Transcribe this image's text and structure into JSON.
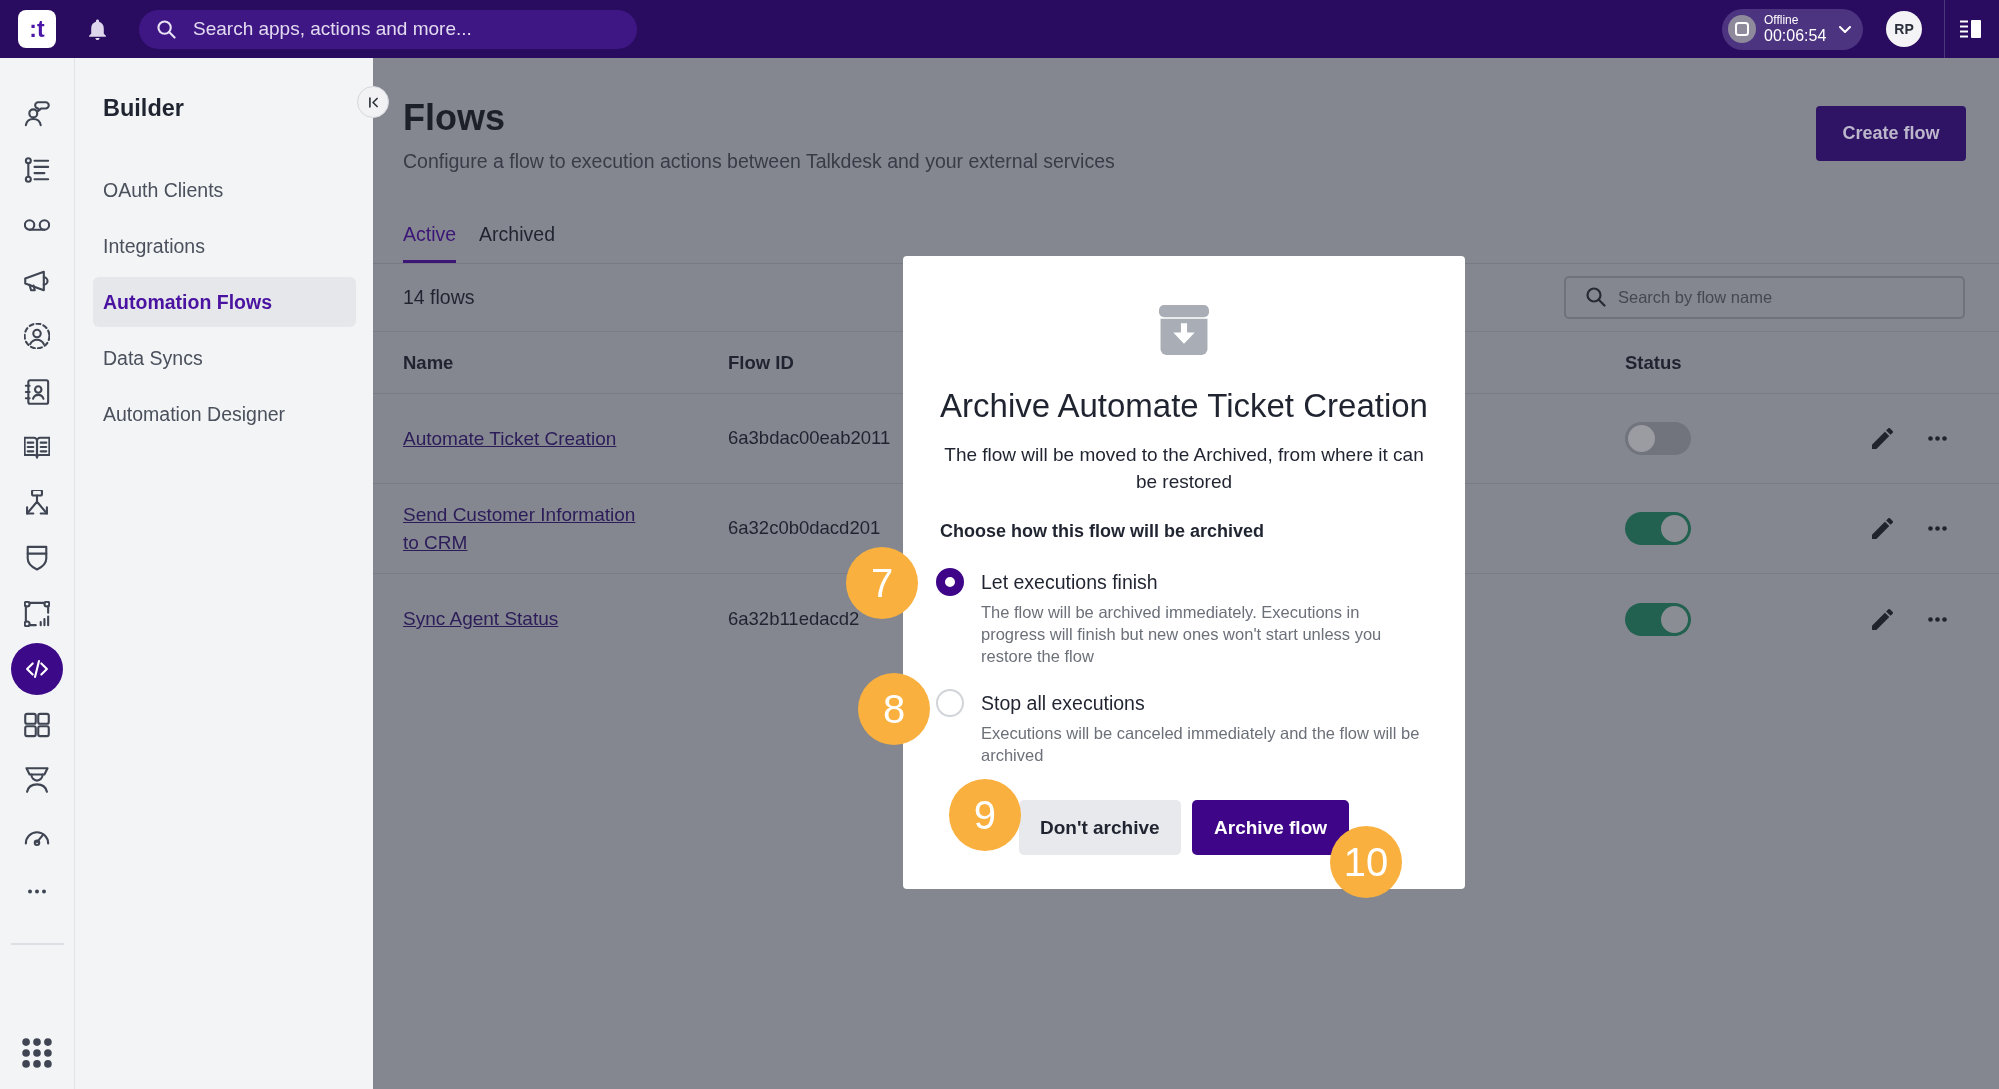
{
  "top_bar": {
    "logo": ":t",
    "search": {
      "placeholder": "Search apps, actions and more..."
    },
    "status": {
      "label": "Offline",
      "timer": "00:06:54"
    },
    "avatar": "RP"
  },
  "rail": {
    "items": [
      {
        "selected": false
      },
      {
        "selected": false
      },
      {
        "selected": false
      },
      {
        "selected": false
      },
      {
        "selected": false
      },
      {
        "selected": false
      },
      {
        "selected": false
      },
      {
        "selected": false
      },
      {
        "selected": false
      },
      {
        "selected": false
      },
      {
        "selected": true
      },
      {
        "selected": false
      },
      {
        "selected": false
      },
      {
        "selected": false
      },
      {
        "selected": false
      }
    ]
  },
  "sidebar": {
    "title": "Builder",
    "items": [
      {
        "label": "OAuth Clients",
        "selected": false
      },
      {
        "label": "Integrations",
        "selected": false
      },
      {
        "label": "Automation Flows",
        "selected": true
      },
      {
        "label": "Data Syncs",
        "selected": false
      },
      {
        "label": "Automation Designer",
        "selected": false
      }
    ]
  },
  "page": {
    "title": "Flows",
    "subtitle": "Configure a flow to execution actions between Talkdesk and your external services",
    "create_button": "Create flow"
  },
  "tabs": [
    {
      "label": "Active",
      "selected": true
    },
    {
      "label": "Archived",
      "selected": false
    }
  ],
  "toolbar": {
    "count": "14 flows",
    "search": {
      "placeholder": "Search by flow name"
    }
  },
  "table": {
    "columns": [
      "Name",
      "Flow ID",
      "Status"
    ],
    "rows": [
      {
        "name": "Automate Ticket Creation",
        "flow_id": "6a3bdac00eab2011",
        "on": false
      },
      {
        "name": "Send Customer Information to CRM",
        "flow_id": "6a32c0b0dacd201",
        "on": true
      },
      {
        "name": "Sync Agent Status",
        "flow_id": "6a32b11edacd2",
        "on": true
      }
    ]
  },
  "dialog": {
    "title": "Archive Automate Ticket Creation",
    "message": "The flow will be moved to the Archived, from where it can be restored",
    "prompt": "Choose how this flow will be archived",
    "options": [
      {
        "label": "Let executions finish",
        "description": "The flow will be archived immediately. Executions in progress will finish but new ones won't start unless you restore the flow",
        "selected": true,
        "callout": "7"
      },
      {
        "label": "Stop all executions",
        "description": "Executions will be canceled immediately and the flow will be archived",
        "selected": false,
        "callout": "8"
      }
    ],
    "buttons": [
      {
        "label": "Don't archive",
        "kind": "secondary",
        "callout": "9"
      },
      {
        "label": "Archive flow",
        "kind": "primary",
        "callout": "10"
      }
    ]
  }
}
